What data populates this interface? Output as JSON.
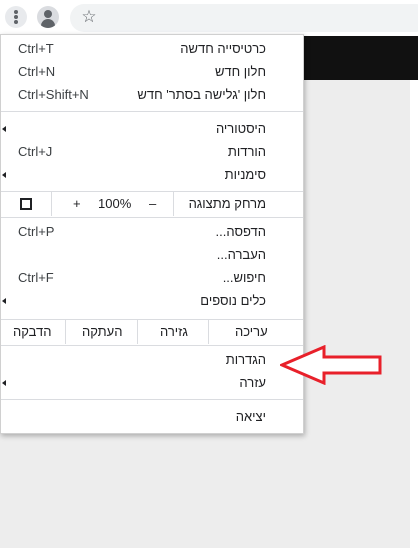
{
  "menu": {
    "items": [
      {
        "label": "כרטיסייה חדשה",
        "shortcut": "Ctrl+T"
      },
      {
        "label": "חלון חדש",
        "shortcut": "Ctrl+N"
      },
      {
        "label": "חלון 'גלישה בסתר' חדש",
        "shortcut": "Ctrl+Shift+N"
      },
      {
        "label": "היסטוריה"
      },
      {
        "label": "הורדות",
        "shortcut": "Ctrl+J"
      },
      {
        "label": "סימניות"
      },
      {
        "label": "הדפסה...",
        "shortcut": "Ctrl+P"
      },
      {
        "label": "העברה..."
      },
      {
        "label": "חיפוש...",
        "shortcut": "Ctrl+F"
      },
      {
        "label": "כלים נוספים"
      },
      {
        "label": "הגדרות"
      },
      {
        "label": "עזרה"
      },
      {
        "label": "יציאה"
      }
    ],
    "zoom": {
      "label": "מרחק מתצוגה",
      "minus": "–",
      "plus": "+",
      "value": "100%"
    },
    "edit": {
      "label": "עריכה",
      "cut": "גזירה",
      "copy": "העתקה",
      "paste": "הדבקה"
    }
  },
  "toolbar": {
    "star": "☆"
  },
  "colors": {
    "annotation_arrow": "#e8202a"
  }
}
